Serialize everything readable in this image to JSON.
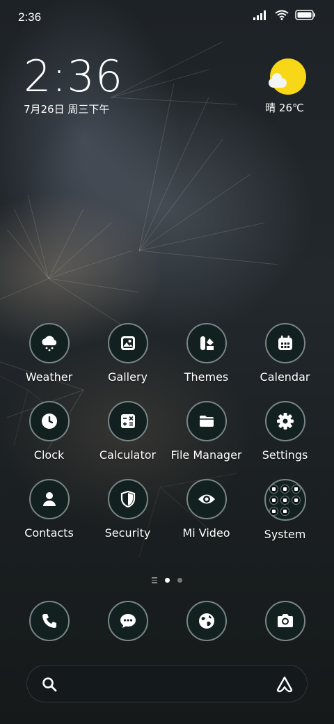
{
  "status_bar": {
    "time": "2:36",
    "icons": [
      "signal-icon",
      "wifi-icon",
      "battery-icon"
    ]
  },
  "clock_widget": {
    "time": "2:36",
    "date": "7月26日 周三下午"
  },
  "weather_widget": {
    "icon": "sun-cloud-icon",
    "text": "晴 26℃"
  },
  "apps": [
    {
      "label": "Weather",
      "icon": "cloud-snow-icon"
    },
    {
      "label": "Gallery",
      "icon": "image-icon"
    },
    {
      "label": "Themes",
      "icon": "themes-icon"
    },
    {
      "label": "Calendar",
      "icon": "calendar-icon"
    },
    {
      "label": "Clock",
      "icon": "clock-icon"
    },
    {
      "label": "Calculator",
      "icon": "calculator-icon"
    },
    {
      "label": "File Manager",
      "icon": "folder-icon"
    },
    {
      "label": "Settings",
      "icon": "gear-icon"
    },
    {
      "label": "Contacts",
      "icon": "person-icon"
    },
    {
      "label": "Security",
      "icon": "shield-icon"
    },
    {
      "label": "Mi Video",
      "icon": "eye-icon"
    },
    {
      "label": "System",
      "icon": "folder-grid-icon"
    }
  ],
  "page_indicator": {
    "pages": 2,
    "active": 1
  },
  "dock": [
    {
      "icon": "phone-icon"
    },
    {
      "icon": "message-icon"
    },
    {
      "icon": "globe-icon"
    },
    {
      "icon": "camera-icon"
    }
  ],
  "search_bar": {
    "left_icon": "search-icon",
    "right_icon": "assistant-icon"
  },
  "colors": {
    "sun": "#f7d716",
    "icon_bg": "#132020",
    "icon_ring": "#7a8686"
  }
}
